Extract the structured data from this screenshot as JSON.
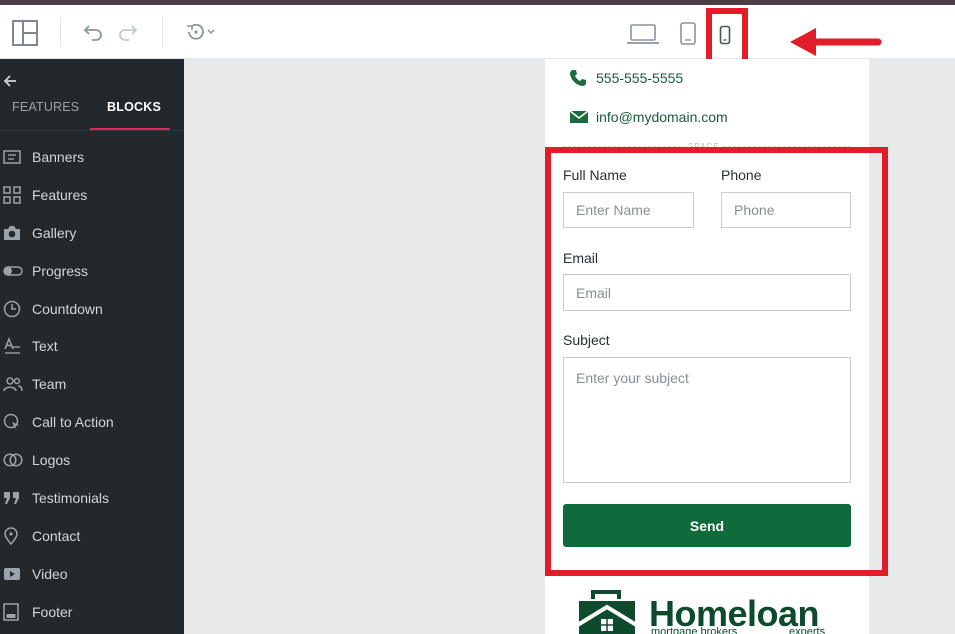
{
  "toolbar": {
    "icons": [
      "layout-icon",
      "undo-icon",
      "redo-icon",
      "history-icon",
      "laptop-icon",
      "tablet-icon",
      "mobile-icon"
    ]
  },
  "sidebar": {
    "tabs": [
      {
        "label": "FEATURES",
        "active": false
      },
      {
        "label": "BLOCKS",
        "active": true
      }
    ],
    "items": [
      {
        "label": "Banners",
        "icon": "banner-icon"
      },
      {
        "label": "Features",
        "icon": "grid-icon"
      },
      {
        "label": "Gallery",
        "icon": "camera-icon"
      },
      {
        "label": "Progress",
        "icon": "progress-icon"
      },
      {
        "label": "Countdown",
        "icon": "clock-icon"
      },
      {
        "label": "Text",
        "icon": "text-icon"
      },
      {
        "label": "Team",
        "icon": "team-icon"
      },
      {
        "label": "Call to Action",
        "icon": "cta-icon"
      },
      {
        "label": "Logos",
        "icon": "logos-icon"
      },
      {
        "label": "Testimonials",
        "icon": "quote-icon"
      },
      {
        "label": "Contact",
        "icon": "location-icon"
      },
      {
        "label": "Video",
        "icon": "video-icon"
      },
      {
        "label": "Footer",
        "icon": "footer-icon"
      }
    ]
  },
  "page": {
    "phone": "555-555-5555",
    "email": "info@mydomain.com",
    "space_label": "SPACE",
    "form": {
      "full_name_label": "Full Name",
      "full_name_placeholder": "Enter Name",
      "phone_label": "Phone",
      "phone_placeholder": "Phone",
      "email_label": "Email",
      "email_placeholder": "Email",
      "subject_label": "Subject",
      "subject_placeholder": "Enter your subject",
      "send_label": "Send"
    },
    "logo": {
      "name": "Homeloan",
      "tagline_left": "mortgage brokers",
      "tagline_right": "experts"
    }
  },
  "colors": {
    "accent_green": "#0f6b3c",
    "highlight_red": "#e21d2a",
    "sidebar_bg": "#23282d",
    "active_tab_underline": "#e0245e"
  }
}
